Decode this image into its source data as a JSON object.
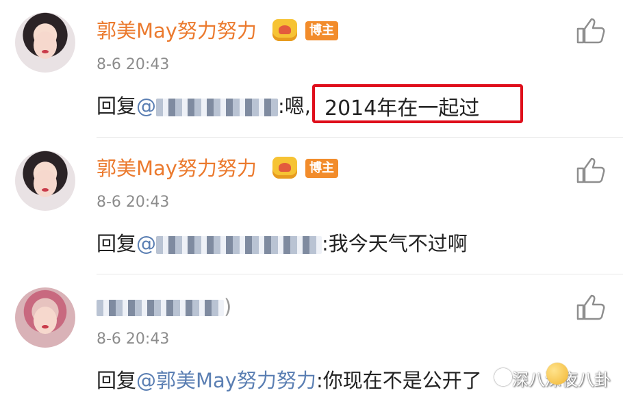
{
  "comments": [
    {
      "author": "郭美May努力努力",
      "badge": "博主",
      "time": "8-6 20:43",
      "reply_prefix": "回复",
      "mention": "@",
      "reply_text": ":嗯,",
      "highlighted_text": "2014年在一起过"
    },
    {
      "author": "郭美May努力努力",
      "badge": "博主",
      "time": "8-6 20:43",
      "reply_prefix": "回复",
      "mention": "@",
      "reply_text": ":我今天气不过啊"
    },
    {
      "author": ")",
      "time": "8-6 20:43",
      "reply_prefix": "回复",
      "mention": "@郭美May努力努力",
      "reply_text": ":你现在不是公开了"
    }
  ],
  "watermark": "深八深夜八卦",
  "colors": {
    "author": "#eb7a2e",
    "mention": "#5b7fb3",
    "highlight_border": "#df0e1b",
    "badge": "#f28c2b"
  },
  "icons": [
    "crown-icon",
    "thumbs-up-icon",
    "watermark-icon",
    "emoji-icon"
  ]
}
